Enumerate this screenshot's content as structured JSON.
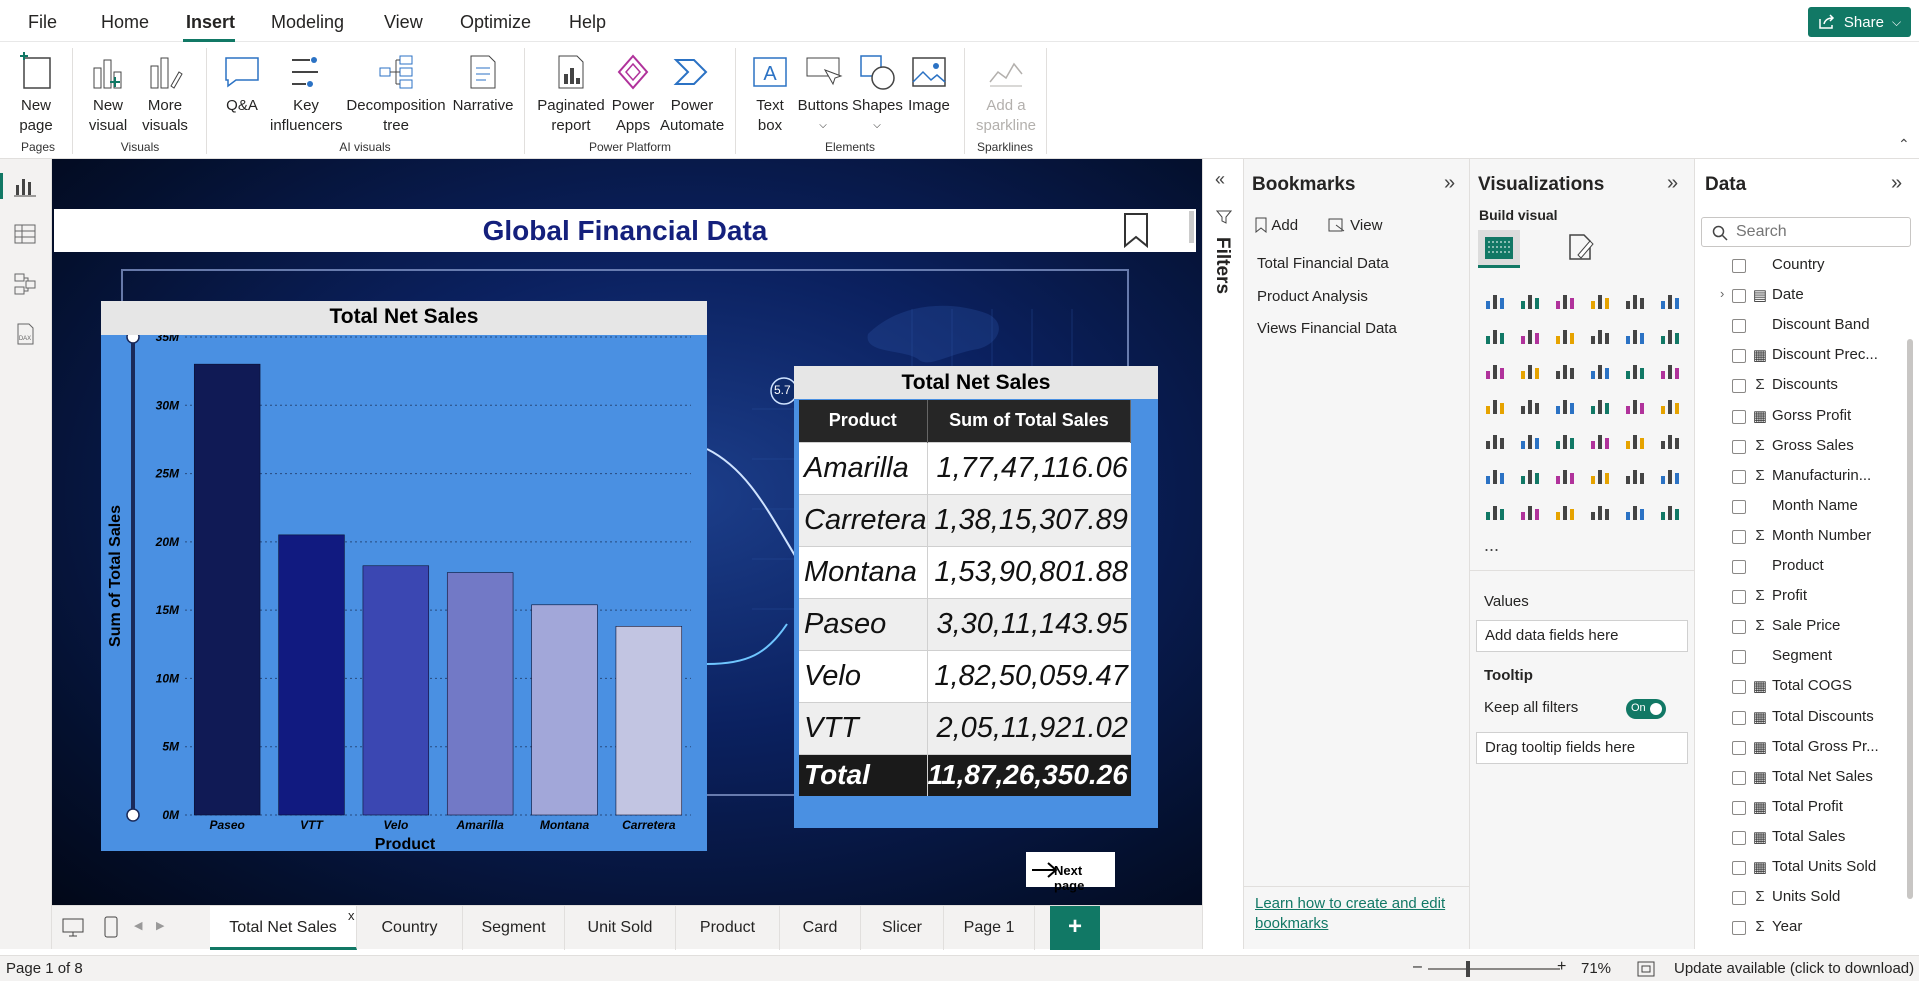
{
  "menu": {
    "items": [
      "File",
      "Home",
      "Insert",
      "Modeling",
      "View",
      "Optimize",
      "Help"
    ],
    "active": "Insert",
    "share_label": "Share"
  },
  "ribbon": {
    "new_page": "New page",
    "new_visual": "New visual",
    "more_visuals": "More visuals",
    "qa": "Q&A",
    "key_influencers": "Key influencers",
    "decomposition_tree": "Decomposition tree",
    "narrative": "Narrative",
    "paginated_report": "Paginated report",
    "power_apps": "Power Apps",
    "power_automate": "Power Automate",
    "text_box": "Text box",
    "buttons": "Buttons",
    "shapes": "Shapes",
    "image": "Image",
    "add_sparkline": "Add a sparkline",
    "groups": {
      "pages": "Pages",
      "visuals": "Visuals",
      "ai_visuals": "AI visuals",
      "power_platform": "Power Platform",
      "elements": "Elements",
      "sparklines": "Sparklines"
    }
  },
  "report": {
    "title": "Global Financial Data",
    "bubble_label": "5.7",
    "next_page_label": "Next page"
  },
  "chart_data": {
    "type": "bar",
    "title": "Total Net Sales",
    "xlabel": "Product",
    "ylabel": "Sum of Total Sales",
    "categories": [
      "Paseo",
      "VTT",
      "Velo",
      "Amarilla",
      "Montana",
      "Carretera"
    ],
    "values": [
      33011143.95,
      20511921.02,
      18250059.47,
      17747116.06,
      15390801.88,
      13815307.89
    ],
    "colors": [
      "#101a55",
      "#111a80",
      "#3b47b2",
      "#7279c6",
      "#a2a7d9",
      "#c2c5e2"
    ],
    "ylim": [
      0,
      35000000
    ],
    "yticks": [
      "0M",
      "5M",
      "10M",
      "15M",
      "20M",
      "25M",
      "30M",
      "35M"
    ],
    "grid": true
  },
  "sales_table": {
    "title": "Total Net Sales",
    "headers": [
      "Product",
      "Sum of Total Sales"
    ],
    "rows": [
      [
        "Amarilla",
        "1,77,47,116.06"
      ],
      [
        "Carretera",
        "1,38,15,307.89"
      ],
      [
        "Montana",
        "1,53,90,801.88"
      ],
      [
        "Paseo",
        "3,30,11,143.95"
      ],
      [
        "Velo",
        "1,82,50,059.47"
      ],
      [
        "VTT",
        "2,05,11,921.02"
      ]
    ],
    "total_label": "Total",
    "total_value": "11,87,26,350.26"
  },
  "page_tabs": [
    "Total Net Sales",
    "Country",
    "Segment",
    "Unit Sold",
    "Product",
    "Card",
    "Slicer",
    "Page 1"
  ],
  "close_tab_label": "x",
  "add_tab_label": "+",
  "status": {
    "page": "Page 1 of 8",
    "zoom": "71%",
    "update": "Update available (click to download)"
  },
  "filters_label": "Filters",
  "bookmarks": {
    "title": "Bookmarks",
    "add_label": "Add",
    "view_label": "View",
    "items": [
      "Total Financial Data",
      "Product Analysis",
      "Views Financial Data"
    ],
    "learn_link": "Learn how to create and edit bookmarks"
  },
  "visualizations": {
    "title": "Visualizations",
    "build_visual": "Build visual",
    "values_label": "Values",
    "values_placeholder": "Add data fields here",
    "tooltip_label": "Tooltip",
    "keep_filters_label": "Keep all filters",
    "toggle_label": "On",
    "tooltip_placeholder": "Drag tooltip fields here",
    "more_label": "..."
  },
  "data_pane": {
    "title": "Data",
    "search_placeholder": "Search",
    "fields": [
      {
        "name": "Country",
        "sym": ""
      },
      {
        "name": "Date",
        "sym": "cal"
      },
      {
        "name": "Discount Band",
        "sym": ""
      },
      {
        "name": "Discount Prec...",
        "sym": "calc"
      },
      {
        "name": "Discounts",
        "sym": "sum"
      },
      {
        "name": "Gorss Profit",
        "sym": "calc"
      },
      {
        "name": "Gross Sales",
        "sym": "sum"
      },
      {
        "name": "Manufacturin...",
        "sym": "sum"
      },
      {
        "name": "Month Name",
        "sym": ""
      },
      {
        "name": "Month Number",
        "sym": "sum"
      },
      {
        "name": "Product",
        "sym": ""
      },
      {
        "name": "Profit",
        "sym": "sum"
      },
      {
        "name": "Sale Price",
        "sym": "sum"
      },
      {
        "name": "Segment",
        "sym": ""
      },
      {
        "name": "Total COGS",
        "sym": "calc"
      },
      {
        "name": "Total Discounts",
        "sym": "calc"
      },
      {
        "name": "Total Gross Pr...",
        "sym": "calc"
      },
      {
        "name": "Total Net Sales",
        "sym": "calc"
      },
      {
        "name": "Total Profit",
        "sym": "calc"
      },
      {
        "name": "Total Sales",
        "sym": "calc"
      },
      {
        "name": "Total Units Sold",
        "sym": "calc"
      },
      {
        "name": "Units Sold",
        "sym": "sum"
      },
      {
        "name": "Year",
        "sym": "sum"
      }
    ]
  }
}
